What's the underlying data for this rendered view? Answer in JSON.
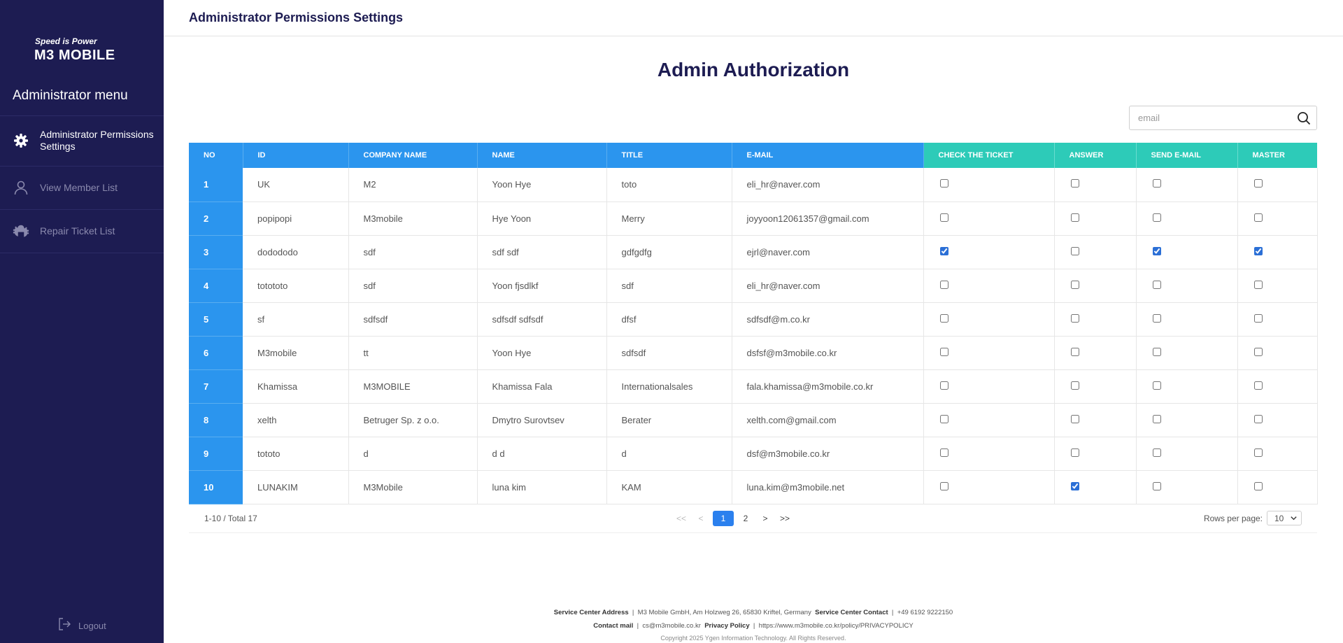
{
  "sidebar": {
    "logo_tagline": "Speed is Power",
    "logo_name": "M3 MOBILE",
    "menu_title": "Administrator menu",
    "items": [
      {
        "label": "Administrator Permissions Settings",
        "icon": "gear-icon",
        "active": true
      },
      {
        "label": "View Member List",
        "icon": "user-icon",
        "active": false
      },
      {
        "label": "Repair Ticket List",
        "icon": "repair-icon",
        "active": false
      }
    ],
    "logout_label": "Logout"
  },
  "header": {
    "title": "Administrator Permissions Settings"
  },
  "main": {
    "page_title": "Admin Authorization",
    "search": {
      "placeholder": "email",
      "value": ""
    },
    "columns": [
      "NO",
      "ID",
      "COMPANY NAME",
      "NAME",
      "TITLE",
      "E-MAIL",
      "CHECK THE TICKET",
      "ANSWER",
      "SEND E-MAIL",
      "MASTER"
    ],
    "rows": [
      {
        "no": "1",
        "id": "UK",
        "company": "M2",
        "name": "Yoon Hye",
        "title": "toto",
        "email": "eli_hr@naver.com",
        "check_ticket": false,
        "answer": false,
        "send_email": false,
        "master": false
      },
      {
        "no": "2",
        "id": "popipopi",
        "company": "M3mobile",
        "name": "Hye Yoon",
        "title": "Merry",
        "email": "joyyoon12061357@gmail.com",
        "check_ticket": false,
        "answer": false,
        "send_email": false,
        "master": false
      },
      {
        "no": "3",
        "id": "dodododo",
        "company": "sdf",
        "name": "sdf sdf",
        "title": "gdfgdfg",
        "email": "ejrl@naver.com",
        "check_ticket": true,
        "answer": false,
        "send_email": true,
        "master": true
      },
      {
        "no": "4",
        "id": "totototo",
        "company": "sdf",
        "name": "Yoon fjsdlkf",
        "title": "sdf",
        "email": "eli_hr@naver.com",
        "check_ticket": false,
        "answer": false,
        "send_email": false,
        "master": false
      },
      {
        "no": "5",
        "id": "sf",
        "company": "sdfsdf",
        "name": "sdfsdf sdfsdf",
        "title": "dfsf",
        "email": "sdfsdf@m.co.kr",
        "check_ticket": false,
        "answer": false,
        "send_email": false,
        "master": false
      },
      {
        "no": "6",
        "id": "M3mobile",
        "company": "tt",
        "name": "Yoon Hye",
        "title": "sdfsdf",
        "email": "dsfsf@m3mobile.co.kr",
        "check_ticket": false,
        "answer": false,
        "send_email": false,
        "master": false
      },
      {
        "no": "7",
        "id": "Khamissa",
        "company": "M3MOBILE",
        "name": "Khamissa Fala",
        "title": "Internationalsales",
        "email": "fala.khamissa@m3mobile.co.kr",
        "check_ticket": false,
        "answer": false,
        "send_email": false,
        "master": false
      },
      {
        "no": "8",
        "id": "xelth",
        "company": "Betruger Sp. z o.o.",
        "name": "Dmytro Surovtsev",
        "title": "Berater",
        "email": "xelth.com@gmail.com",
        "check_ticket": false,
        "answer": false,
        "send_email": false,
        "master": false
      },
      {
        "no": "9",
        "id": "tototo",
        "company": "d",
        "name": "d d",
        "title": "d",
        "email": "dsf@m3mobile.co.kr",
        "check_ticket": false,
        "answer": false,
        "send_email": false,
        "master": false
      },
      {
        "no": "10",
        "id": "LUNAKIM",
        "company": "M3Mobile",
        "name": "luna kim",
        "title": "KAM",
        "email": "luna.kim@m3mobile.net",
        "check_ticket": false,
        "answer": true,
        "send_email": false,
        "master": false
      }
    ],
    "pagination": {
      "range_text": "1-10 / Total 17",
      "first": "<<",
      "prev": "<",
      "pages": [
        "1",
        "2"
      ],
      "current": "1",
      "next": ">",
      "last": ">>",
      "rows_per_page_label": "Rows per page:",
      "rows_per_page_value": "10"
    }
  },
  "footer": {
    "address_label": "Service Center Address",
    "address": "M3 Mobile GmbH, Am Holzweg 26, 65830 Kriftel, Germany",
    "contact_label": "Service Center Contact",
    "contact": "+49 6192 9222150",
    "mail_label": "Contact mail",
    "mail": "cs@m3mobile.co.kr",
    "privacy_label": "Privacy Policy",
    "privacy_url": "https://www.m3mobile.co.kr/policy/PRIVACYPOLICY",
    "copyright": "Copyright 2025 Ygen Information Technology. All Rights Reserved."
  },
  "colors": {
    "sidebar_bg": "#1d1c52",
    "header_blue": "#2b95ee",
    "header_teal": "#2dcbb8",
    "title_navy": "#1d1c52",
    "pager_active": "#2b80ee"
  }
}
